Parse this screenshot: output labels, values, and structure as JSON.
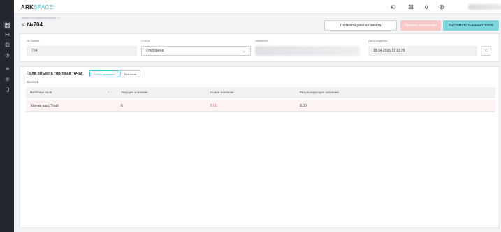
{
  "sidebar": {
    "icons": [
      "grid-icon",
      "layers-icon",
      "panel-icon",
      "clock-icon",
      "list-icon",
      "settings-icon",
      "document-icon"
    ]
  },
  "header": {
    "logo_main": "ARK",
    "logo_accent": "SPACE",
    "icons": [
      "mail-icon",
      "apps-grid-icon",
      "bell-icon",
      "compass-icon"
    ]
  },
  "page": {
    "breadcrumb": "Заявки на редактирование ТТ",
    "back_arrow": "<",
    "title": "№704"
  },
  "actions": {
    "segment_form": "Сегментационная анкета",
    "approve": "Принять изменения",
    "calculate": "Рассчитать значения полей"
  },
  "request_info": {
    "id_label": "№ Заявки",
    "id_value": "704",
    "status_label": "Статус",
    "status_value": "Отклонена",
    "requester_label": "Заявитель",
    "created_label": "Дата создания",
    "created_value": "18.04.2025 11:13:26",
    "close_label": "x"
  },
  "fields_section": {
    "title": "Поля объекта торговая точка",
    "toggle_new": "Новое значение",
    "toggle_all": "Все поля",
    "total": "Всего: 1",
    "columns": [
      "Название поля",
      "Текущее значение",
      "Новое значение",
      "Результирующее значение"
    ],
    "rows": [
      {
        "name": "Кол-во касс Tradi",
        "current": "6",
        "new": "8.00",
        "result": "8.00"
      }
    ]
  },
  "colors": {
    "accent": "#38c0d0",
    "danger_text": "#e26b5a",
    "row_highlight": "#fdf3f3",
    "rail": "#23272e"
  }
}
